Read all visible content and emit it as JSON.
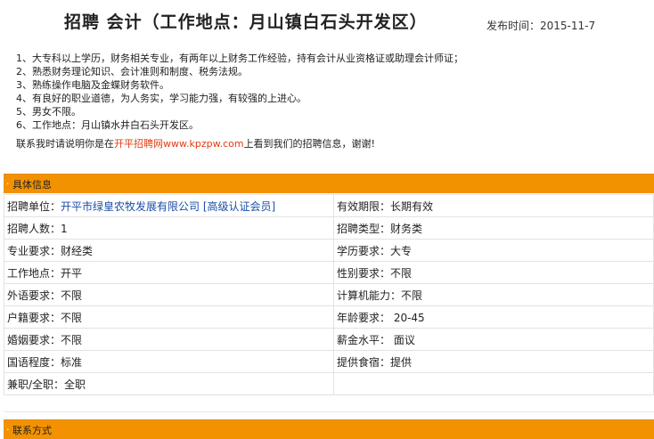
{
  "header": {
    "job_title": "招聘 会计（工作地点：月山镇白石头开发区）",
    "published_label": "发布时间：",
    "published_date": "2015-11-7"
  },
  "requirements": [
    "1、大专科以上学历，财务相关专业，有两年以上财务工作经验，持有会计从业资格证或助理会计师证；",
    "2、熟悉财务理论知识、会计准则和制度、税务法规。",
    "3、熟练操作电脑及金蝶财务软件。",
    "4、有良好的职业道德，为人务实，学习能力强，有较强的上进心。",
    "5、男女不限。",
    "6、工作地点：月山镇水井白石头开发区。"
  ],
  "contact_note": {
    "prefix": "联系我时请说明你是在",
    "site_name": "开平招聘网",
    "site_url": "www.kpzpw.com",
    "suffix": "上看到我们的招聘信息，谢谢!"
  },
  "sections": {
    "details": "具体信息",
    "contact": "联系方式"
  },
  "details": {
    "company_label": "招聘单位：",
    "company_name": "开平市绿皇农牧发展有限公司",
    "company_badge": "[高级认证会员]",
    "rows": [
      [
        "有效期限：长期有效"
      ],
      [
        "招聘人数：1",
        "招聘类型：财务类"
      ],
      [
        "专业要求：财经类",
        "学历要求：大专"
      ],
      [
        "工作地点：开平",
        "性别要求：不限"
      ],
      [
        "外语要求：不限",
        "计算机能力：不限"
      ],
      [
        "户籍要求：不限",
        "年龄要求： 20-45"
      ],
      [
        "婚姻要求：不限",
        "薪金水平： 面议"
      ],
      [
        "国语程度：标准",
        "提供食宿：提供"
      ],
      [
        "兼职/全职：全职",
        ""
      ]
    ]
  }
}
